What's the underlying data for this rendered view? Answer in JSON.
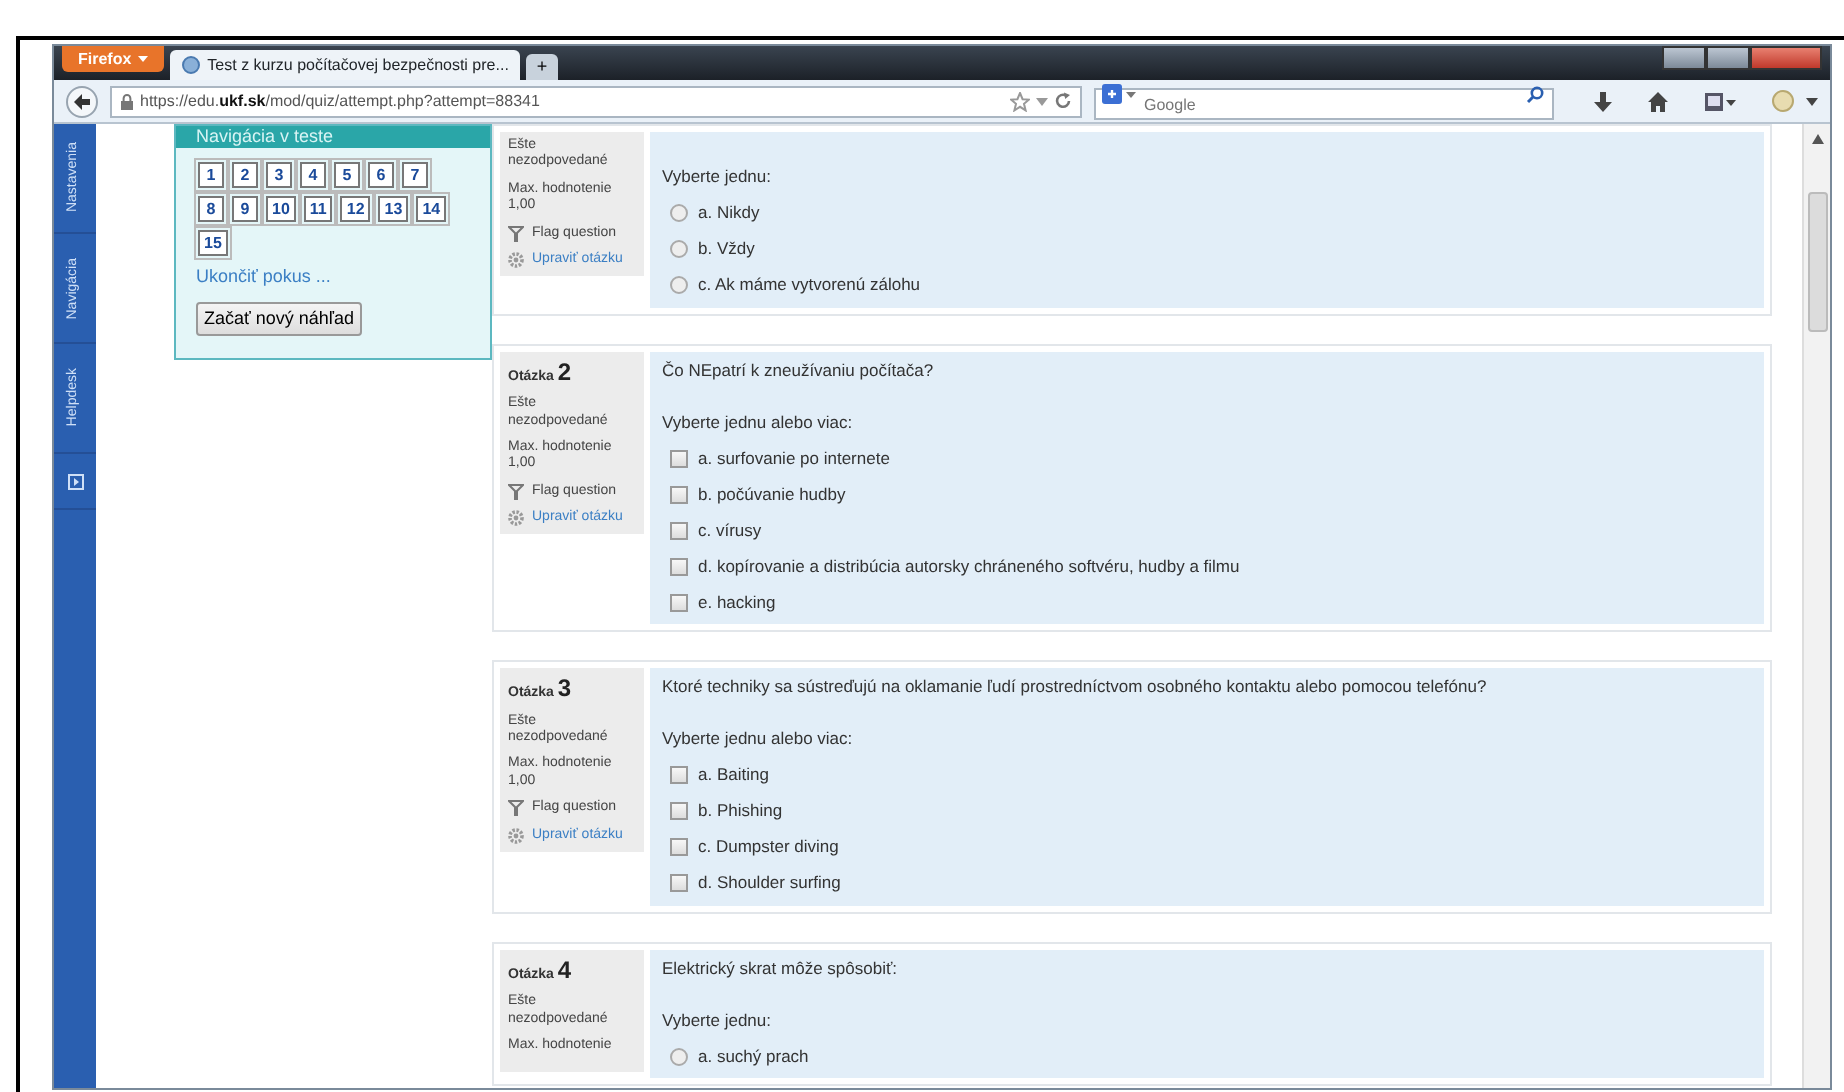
{
  "browser": {
    "menu_button": "Firefox",
    "tabs": [
      {
        "title": "Test z kurzu počítačovej bezpečnosti pre...",
        "selected": true
      }
    ],
    "new_tab": "+",
    "url": "https://edu.**ukf.sk**/mod/quiz/attempt.php?attempt=88341",
    "search": {
      "placeholder": "Google"
    }
  },
  "side_tabs": [
    "Nastavenia",
    "Navigácia",
    "Helpdesk"
  ],
  "quiz_nav": {
    "title": "Navigácia v teste",
    "buttons": [
      "1",
      "2",
      "3",
      "4",
      "5",
      "6",
      "7",
      "8",
      "9",
      "10",
      "11",
      "12",
      "13",
      "14",
      "15"
    ],
    "finish_link": "Ukončiť pokus ...",
    "preview_button": "Začať nový náhľad"
  },
  "questions": [
    {
      "status": "Ešte nezodpovedané",
      "max_label": "Max. hodnotenie",
      "max_value": "1,00",
      "flag": "Flag question",
      "edit": "Upraviť otázku",
      "prompt": "Vyberte jednu:",
      "kind": "radio",
      "options": [
        {
          "label": "a. Nikdy",
          "checked": false
        },
        {
          "label": "b. Vždy",
          "checked": false
        },
        {
          "label": "c. Ak máme vytvorenú zálohu",
          "checked": false
        }
      ]
    },
    {
      "label": "Otázka",
      "number": "2",
      "status": "Ešte nezodpovedané",
      "max_label": "Max. hodnotenie",
      "max_value": "1,00",
      "flag": "Flag question",
      "edit": "Upraviť otázku",
      "text": "Čo NEpatrí k zneužívaniu počítača?",
      "prompt": "Vyberte jednu alebo viac:",
      "kind": "checkbox",
      "options": [
        {
          "label": "a. surfovanie po internete",
          "checked": false
        },
        {
          "label": "b. počúvanie hudby",
          "checked": false
        },
        {
          "label": "c. vírusy",
          "checked": false
        },
        {
          "label": "d. kopírovanie a distribúcia autorsky chráneného softvéru, hudby a filmu",
          "checked": false
        },
        {
          "label": "e. hacking",
          "checked": false
        }
      ]
    },
    {
      "label": "Otázka",
      "number": "3",
      "status": "Ešte nezodpovedané",
      "max_label": "Max. hodnotenie",
      "max_value": "1,00",
      "flag": "Flag question",
      "edit": "Upraviť otázku",
      "text": "Ktoré techniky sa sústreďujú na oklamanie ľudí prostredníctvom osobného kontaktu alebo pomocou telefónu?",
      "prompt": "Vyberte jednu alebo viac:",
      "kind": "checkbox",
      "options": [
        {
          "label": "a. Baiting",
          "checked": false
        },
        {
          "label": "b. Phishing",
          "checked": false
        },
        {
          "label": "c. Dumpster diving",
          "checked": false
        },
        {
          "label": "d. Shoulder surfing",
          "checked": false
        }
      ]
    },
    {
      "label": "Otázka",
      "number": "4",
      "status": "Ešte nezodpovedané",
      "max_label": "Max. hodnotenie",
      "text": "Elektrický skrat môže spôsobiť:",
      "prompt": "Vyberte jednu:",
      "kind": "radio",
      "options": [
        {
          "label": "a. suchý prach",
          "checked": false
        }
      ]
    }
  ]
}
